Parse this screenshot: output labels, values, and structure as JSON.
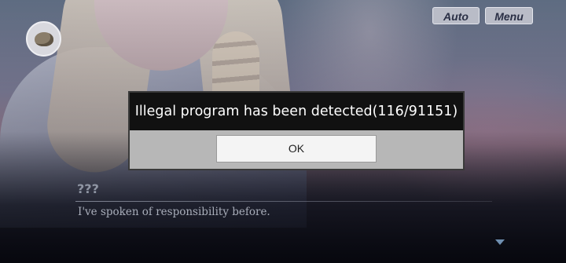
{
  "top_controls": {
    "auto_label": "Auto",
    "menu_label": "Menu"
  },
  "dialogue": {
    "speaker": "???",
    "text": "I've spoken of responsibility before."
  },
  "alert": {
    "message": "Illegal program has been detected(116/91151)",
    "ok_label": "OK"
  },
  "icons": {
    "avatar": "character-portrait-icon",
    "advance": "triangle-down-icon"
  }
}
